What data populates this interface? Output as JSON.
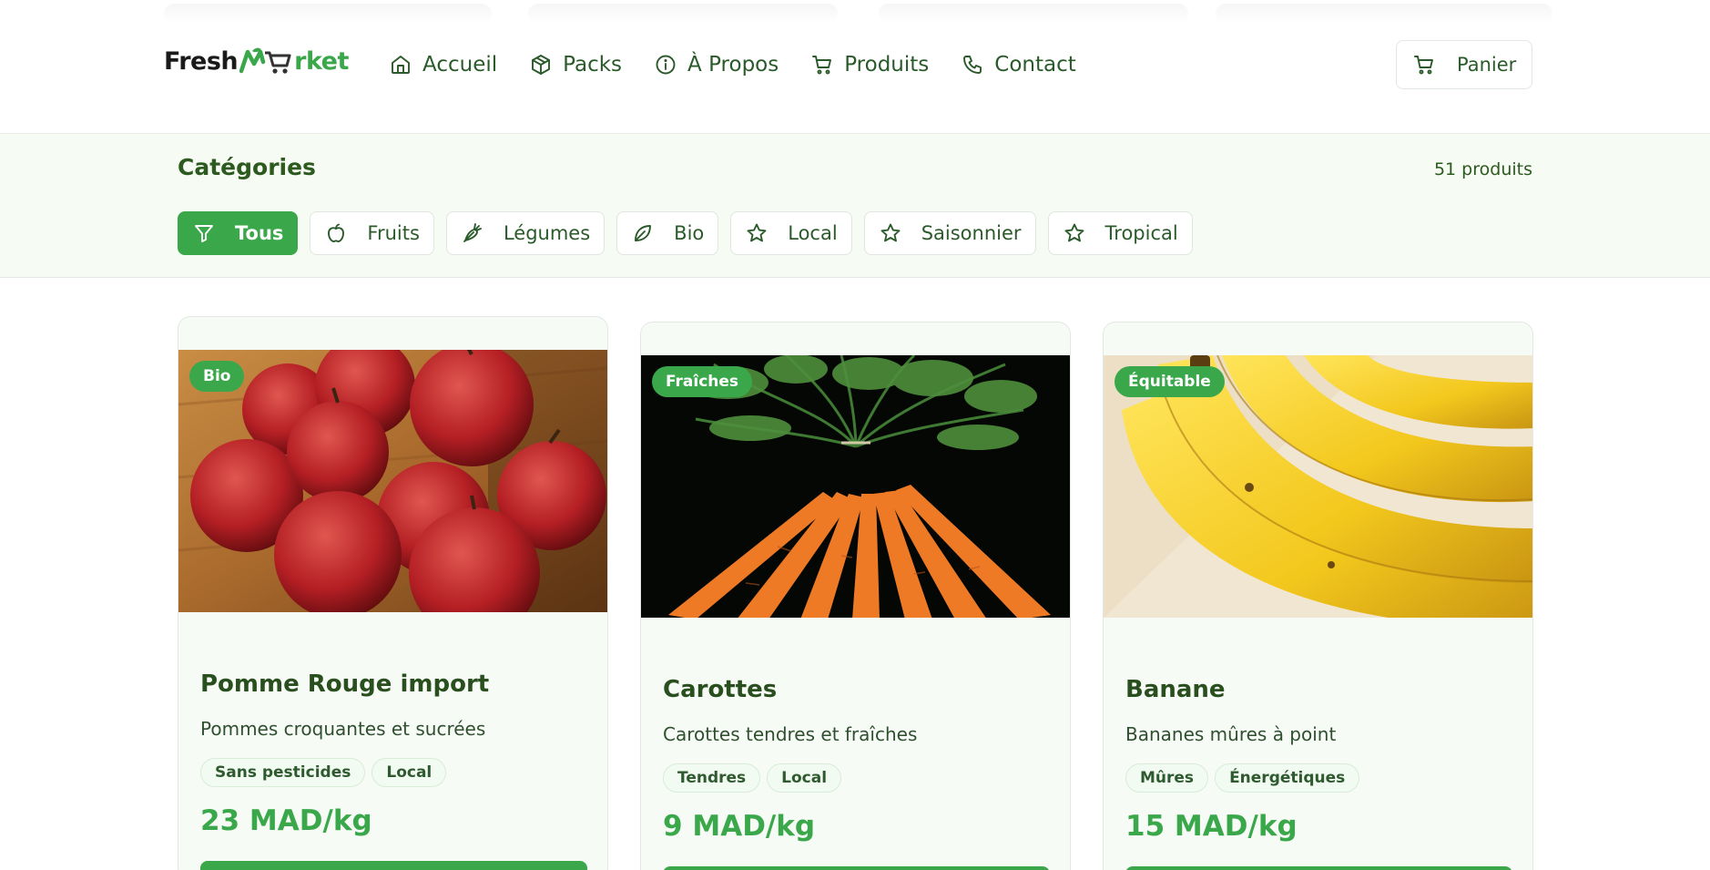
{
  "brand": {
    "left": "Fresh",
    "right": "rket"
  },
  "nav": [
    {
      "label": "Accueil",
      "icon": "home-icon"
    },
    {
      "label": "Packs",
      "icon": "box-icon"
    },
    {
      "label": "À Propos",
      "icon": "info-icon"
    },
    {
      "label": "Produits",
      "icon": "cart-icon"
    },
    {
      "label": "Contact",
      "icon": "phone-icon"
    }
  ],
  "cart": {
    "label": "Panier",
    "icon": "cart-icon"
  },
  "categories": {
    "title": "Catégories",
    "count": "51 produits",
    "chips": [
      {
        "label": "Tous",
        "icon": "filter-icon",
        "active": true
      },
      {
        "label": "Fruits",
        "icon": "apple-icon",
        "active": false
      },
      {
        "label": "Légumes",
        "icon": "carrot-icon",
        "active": false
      },
      {
        "label": "Bio",
        "icon": "leaf-icon",
        "active": false
      },
      {
        "label": "Local",
        "icon": "star-icon",
        "active": false
      },
      {
        "label": "Saisonnier",
        "icon": "star-icon",
        "active": false
      },
      {
        "label": "Tropical",
        "icon": "star-icon",
        "active": false
      }
    ]
  },
  "products": [
    {
      "badge": "Bio",
      "name": "Pomme Rouge import",
      "description": "Pommes croquantes et sucrées",
      "tags": [
        "Sans pesticides",
        "Local"
      ],
      "price": "23 MAD/kg",
      "image": "red-apples-photo"
    },
    {
      "badge": "Fraîches",
      "name": "Carottes",
      "description": "Carottes tendres et fraîches",
      "tags": [
        "Tendres",
        "Local"
      ],
      "price": "9 MAD/kg",
      "image": "carrots-photo"
    },
    {
      "badge": "Équitable",
      "name": "Banane",
      "description": "Bananes mûres à point",
      "tags": [
        "Mûres",
        "Énergétiques"
      ],
      "price": "15 MAD/kg",
      "image": "bananas-photo"
    }
  ],
  "colors": {
    "accent": "#3aa84a",
    "text": "#2a5a2a",
    "band": "#f6fbf4"
  }
}
